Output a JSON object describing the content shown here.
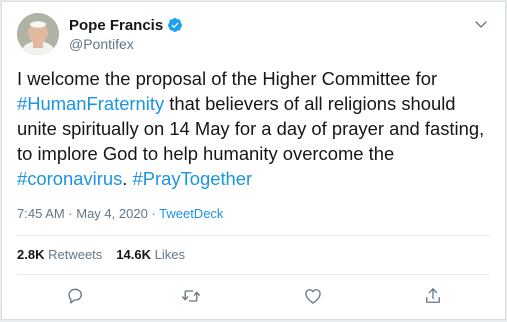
{
  "user": {
    "display_name": "Pope Francis",
    "handle": "@Pontifex",
    "verified": true
  },
  "tweet": {
    "segments": [
      {
        "text": "I welcome the proposal of the Higher Committee for ",
        "type": "text"
      },
      {
        "text": "#HumanFraternity",
        "type": "hashtag"
      },
      {
        "text": " that believers of all religions should unite spiritually on 14 May for a day of prayer and fasting, to implore God to help humanity overcome the ",
        "type": "text"
      },
      {
        "text": "#coronavirus",
        "type": "hashtag"
      },
      {
        "text": ". ",
        "type": "text"
      },
      {
        "text": "#PrayTogether",
        "type": "hashtag"
      }
    ],
    "timestamp": "7:45 AM · May 4, 2020",
    "separator": " · ",
    "source": "TweetDeck"
  },
  "stats": {
    "retweets_count": "2.8K",
    "retweets_label": "Retweets",
    "likes_count": "14.6K",
    "likes_label": "Likes"
  },
  "icons": {
    "verified": "verified-badge-icon",
    "caret": "chevron-down-icon",
    "reply": "reply-icon",
    "retweet": "retweet-icon",
    "like": "heart-icon",
    "share": "share-icon"
  },
  "colors": {
    "accent": "#1b95e0",
    "text": "#14171a",
    "muted": "#657786"
  }
}
